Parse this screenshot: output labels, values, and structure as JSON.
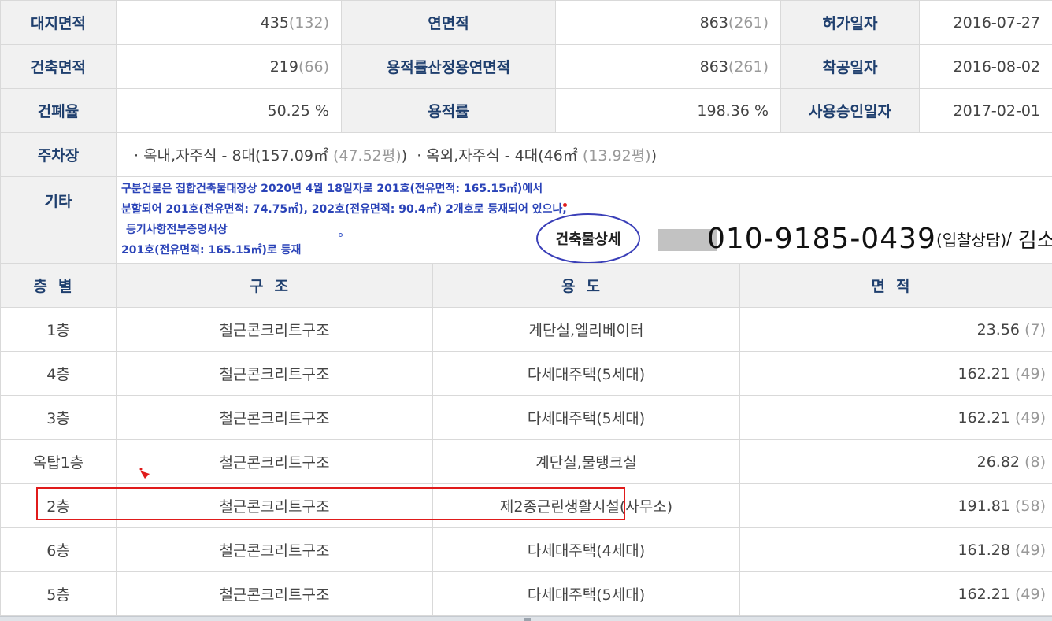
{
  "summary": {
    "row1": {
      "label1": "대지면적",
      "value1": "435",
      "unit1": "(132)",
      "label2": "연면적",
      "value2": "863",
      "unit2": "(261)",
      "label3": "허가일자",
      "value3": "2016-07-27"
    },
    "row2": {
      "label1": "건축면적",
      "value1": "219",
      "unit1": "(66)",
      "label2": "용적률산정용연면적",
      "value2": "863",
      "unit2": "(261)",
      "label3": "착공일자",
      "value3": "2016-08-02"
    },
    "row3": {
      "label1": "건폐율",
      "value1": "50.25 %",
      "label2": "용적률",
      "value2": "198.36 %",
      "label3": "사용승인일자",
      "value3": "2017-02-01"
    }
  },
  "parking": {
    "label": "주차장",
    "indoor": "· 옥내,자주식 - 8대(157.09㎡",
    "indoor_unit": " (47.52평)",
    "indoor_close": ")",
    "outdoor": "· 옥외,자주식 - 4대(46㎡",
    "outdoor_unit": " (13.92평)",
    "outdoor_close": ")"
  },
  "etc": {
    "label": "기타",
    "lines": [
      "구분건물은 집합건축물대장상 2020년 4월 18일자로 201호(전유면적: 165.15㎡)에서",
      "분할되어 201호(전유면적: 74.75㎡), 202호(전유면적: 90.4㎡) 2개호로 등재되어 있으나,",
      "등기사항전부증명서상",
      "201호(전유면적: 165.15㎡)로 등재"
    ],
    "detail_button": "건축물상세",
    "phone": "010-9185-0439",
    "phone_note": "(입찰상담)",
    "phone_sep": " / ",
    "phone_name": "김소장"
  },
  "floors": {
    "headers": [
      "층별",
      "구조",
      "용도",
      "면적"
    ],
    "rows": [
      {
        "floor": "1층",
        "structure": "철근콘크리트구조",
        "use": "계단실,엘리베이터",
        "area": "23.56",
        "area_unit": "(7)"
      },
      {
        "floor": "4층",
        "structure": "철근콘크리트구조",
        "use": "다세대주택(5세대)",
        "area": "162.21",
        "area_unit": "(49)"
      },
      {
        "floor": "3층",
        "structure": "철근콘크리트구조",
        "use": "다세대주택(5세대)",
        "area": "162.21",
        "area_unit": "(49)"
      },
      {
        "floor": "옥탑1층",
        "structure": "철근콘크리트구조",
        "use": "계단실,물탱크실",
        "area": "26.82",
        "area_unit": "(8)"
      },
      {
        "floor": "2층",
        "structure": "철근콘크리트구조",
        "use": "제2종근린생활시설(사무소)",
        "area": "191.81",
        "area_unit": "(58)"
      },
      {
        "floor": "6층",
        "structure": "철근콘크리트구조",
        "use": "다세대주택(4세대)",
        "area": "161.28",
        "area_unit": "(49)"
      },
      {
        "floor": "5층",
        "structure": "철근콘크리트구조",
        "use": "다세대주택(5세대)",
        "area": "162.21",
        "area_unit": "(49)"
      }
    ]
  },
  "colors": {
    "label_bg": "#f1f1f1",
    "label_text": "#1f3f6e",
    "note_blue": "#2a43b8",
    "highlight_red": "#e01b1b"
  }
}
